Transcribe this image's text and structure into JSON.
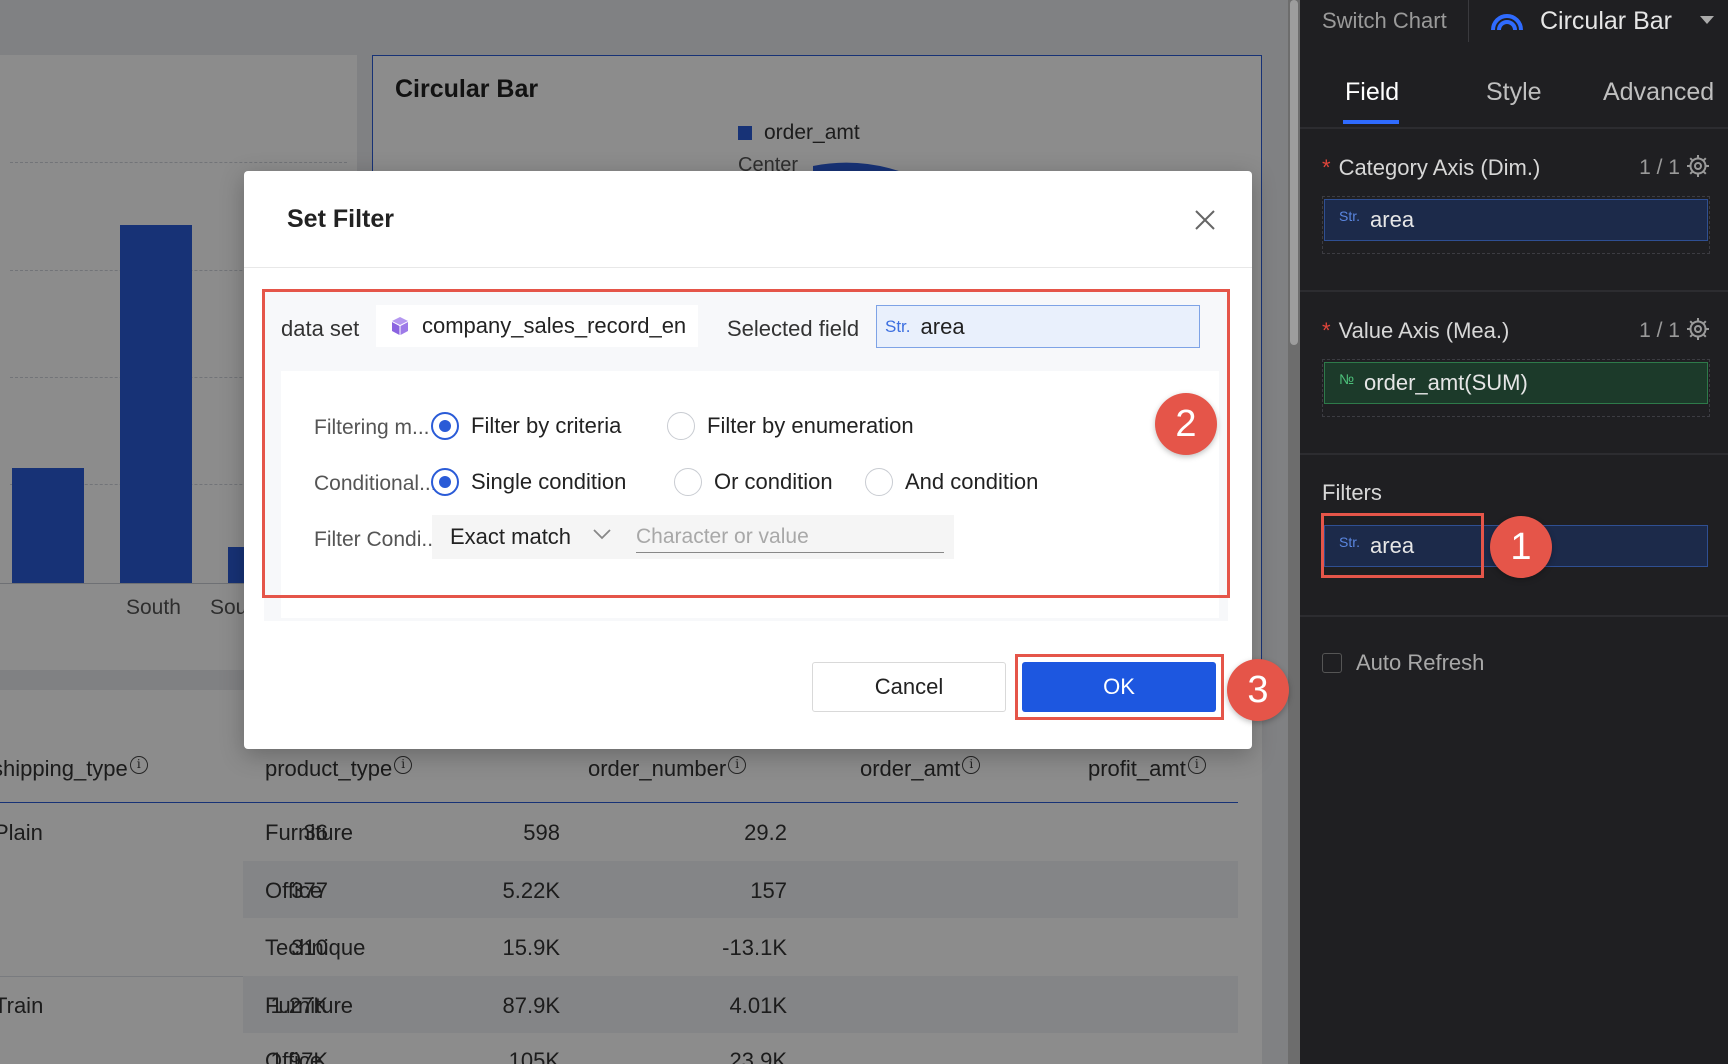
{
  "background": {
    "bar_chart": {
      "categories": [
        "",
        "South",
        "Sou"
      ],
      "bar_levels": [
        0.32,
        1.0,
        0.1
      ]
    },
    "circular_chart": {
      "title": "Circular Bar",
      "legend": "order_amt",
      "category": "Center"
    },
    "table": {
      "columns": [
        "shipping_type",
        "product_type",
        "order_number",
        "order_amt",
        "profit_amt"
      ],
      "rows": [
        {
          "shipping_type": "Plain",
          "product_type": "Furniture",
          "order_number": "36",
          "order_amt": "598",
          "profit_amt": "29.2"
        },
        {
          "shipping_type": "",
          "product_type": "Office",
          "order_number": "377",
          "order_amt": "5.22K",
          "profit_amt": "157"
        },
        {
          "shipping_type": "",
          "product_type": "Technique",
          "order_number": "310",
          "order_amt": "15.9K",
          "profit_amt": "-13.1K"
        },
        {
          "shipping_type": "Train",
          "product_type": "Furniture",
          "order_number": "1.27K",
          "order_amt": "87.9K",
          "profit_amt": "4.01K"
        },
        {
          "shipping_type": "",
          "product_type": "Office",
          "order_number": "1.97K",
          "order_amt": "105K",
          "profit_amt": "23.9K"
        }
      ],
      "info_glyph": "i"
    }
  },
  "panel": {
    "switch_label": "Switch Chart",
    "chart_type": "Circular Bar",
    "tabs": [
      "Field",
      "Style",
      "Advanced"
    ],
    "category_axis": {
      "label": "Category Axis (Dim.)",
      "count": "1 / 1",
      "field": "area",
      "tag": "Str."
    },
    "value_axis": {
      "label": "Value Axis (Mea.)",
      "count": "1 / 1",
      "field": "order_amt(SUM)",
      "tag": "№"
    },
    "filters": {
      "label": "Filters",
      "field": "area",
      "tag": "Str."
    },
    "auto_refresh": "Auto Refresh",
    "required_mark": "*"
  },
  "modal": {
    "title": "Set Filter",
    "dataset_label": "data set",
    "dataset_value": "company_sales_record_en",
    "selected_field_label": "Selected field",
    "selected_field_tag": "Str.",
    "selected_field_value": "area",
    "filtering_mode_label": "Filtering m...",
    "filtering_modes": [
      "Filter by criteria",
      "Filter by enumeration"
    ],
    "conditional_label": "Conditional...",
    "conditions": [
      "Single condition",
      "Or condition",
      "And condition"
    ],
    "filter_condition_label": "Filter Condi...",
    "match_value": "Exact match",
    "value_placeholder": "Character or value",
    "cancel": "Cancel",
    "ok": "OK"
  },
  "callouts": [
    "1",
    "2",
    "3"
  ],
  "colors": {
    "accent": "#2a5bd7",
    "primary_button": "#1d57e0",
    "highlight": "#e55549",
    "panel_bg": "#1f1f22"
  }
}
